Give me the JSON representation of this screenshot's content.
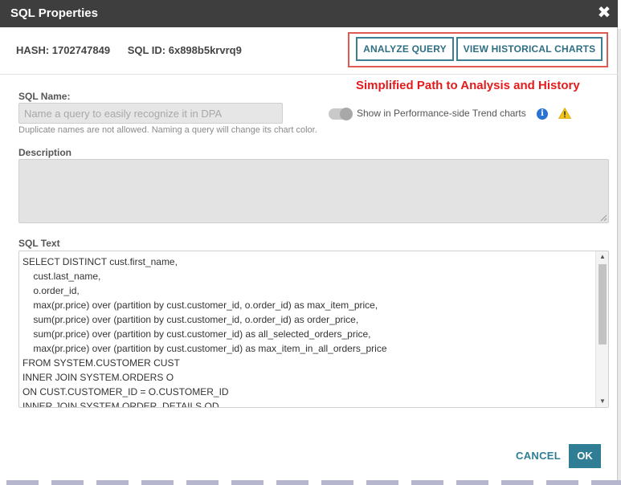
{
  "dialog": {
    "title": "SQL Properties",
    "close_label": "✖"
  },
  "header": {
    "hash": "HASH: 1702747849",
    "sql_id": "SQL ID: 6x898b5krvrq9",
    "analyze_label": "ANALYZE QUERY",
    "history_label": "VIEW HISTORICAL CHARTS",
    "annotation": "Simplified Path to Analysis and History"
  },
  "sql_name": {
    "label": "SQL Name:",
    "placeholder": "Name a query to easily recognize it in DPA",
    "value": "",
    "hint": "Duplicate names are not allowed. Naming a query will change its chart color."
  },
  "trend_toggle": {
    "label": "Show in Performance-side Trend charts",
    "state": "off"
  },
  "description": {
    "label": "Description",
    "value": ""
  },
  "sql_text": {
    "label": "SQL Text",
    "lines": [
      "SELECT DISTINCT cust.first_name,",
      "    cust.last_name,",
      "    o.order_id,",
      "    max(pr.price) over (partition by cust.customer_id, o.order_id) as max_item_price,",
      "    sum(pr.price) over (partition by cust.customer_id, o.order_id) as order_price,",
      "    sum(pr.price) over (partition by cust.customer_id) as all_selected_orders_price,",
      "    max(pr.price) over (partition by cust.customer_id) as max_item_in_all_orders_price",
      "FROM SYSTEM.CUSTOMER CUST",
      "INNER JOIN SYSTEM.ORDERS O",
      "ON CUST.CUSTOMER_ID = O.CUSTOMER_ID",
      "INNER JOIN SYSTEM.ORDER_DETAILS OD"
    ]
  },
  "footer": {
    "cancel_label": "CANCEL",
    "ok_label": "OK"
  },
  "colors": {
    "titlebar": "#3e3e3e",
    "accent": "#2f7e96",
    "annotation": "#e21c1c",
    "highlight_border": "#e05a54",
    "info": "#2a73d0",
    "warning": "#f0c419"
  },
  "icons": [
    "close-icon",
    "info-icon",
    "warning-icon",
    "resize-grip-icon",
    "scroll-up-icon",
    "scroll-down-icon"
  ]
}
